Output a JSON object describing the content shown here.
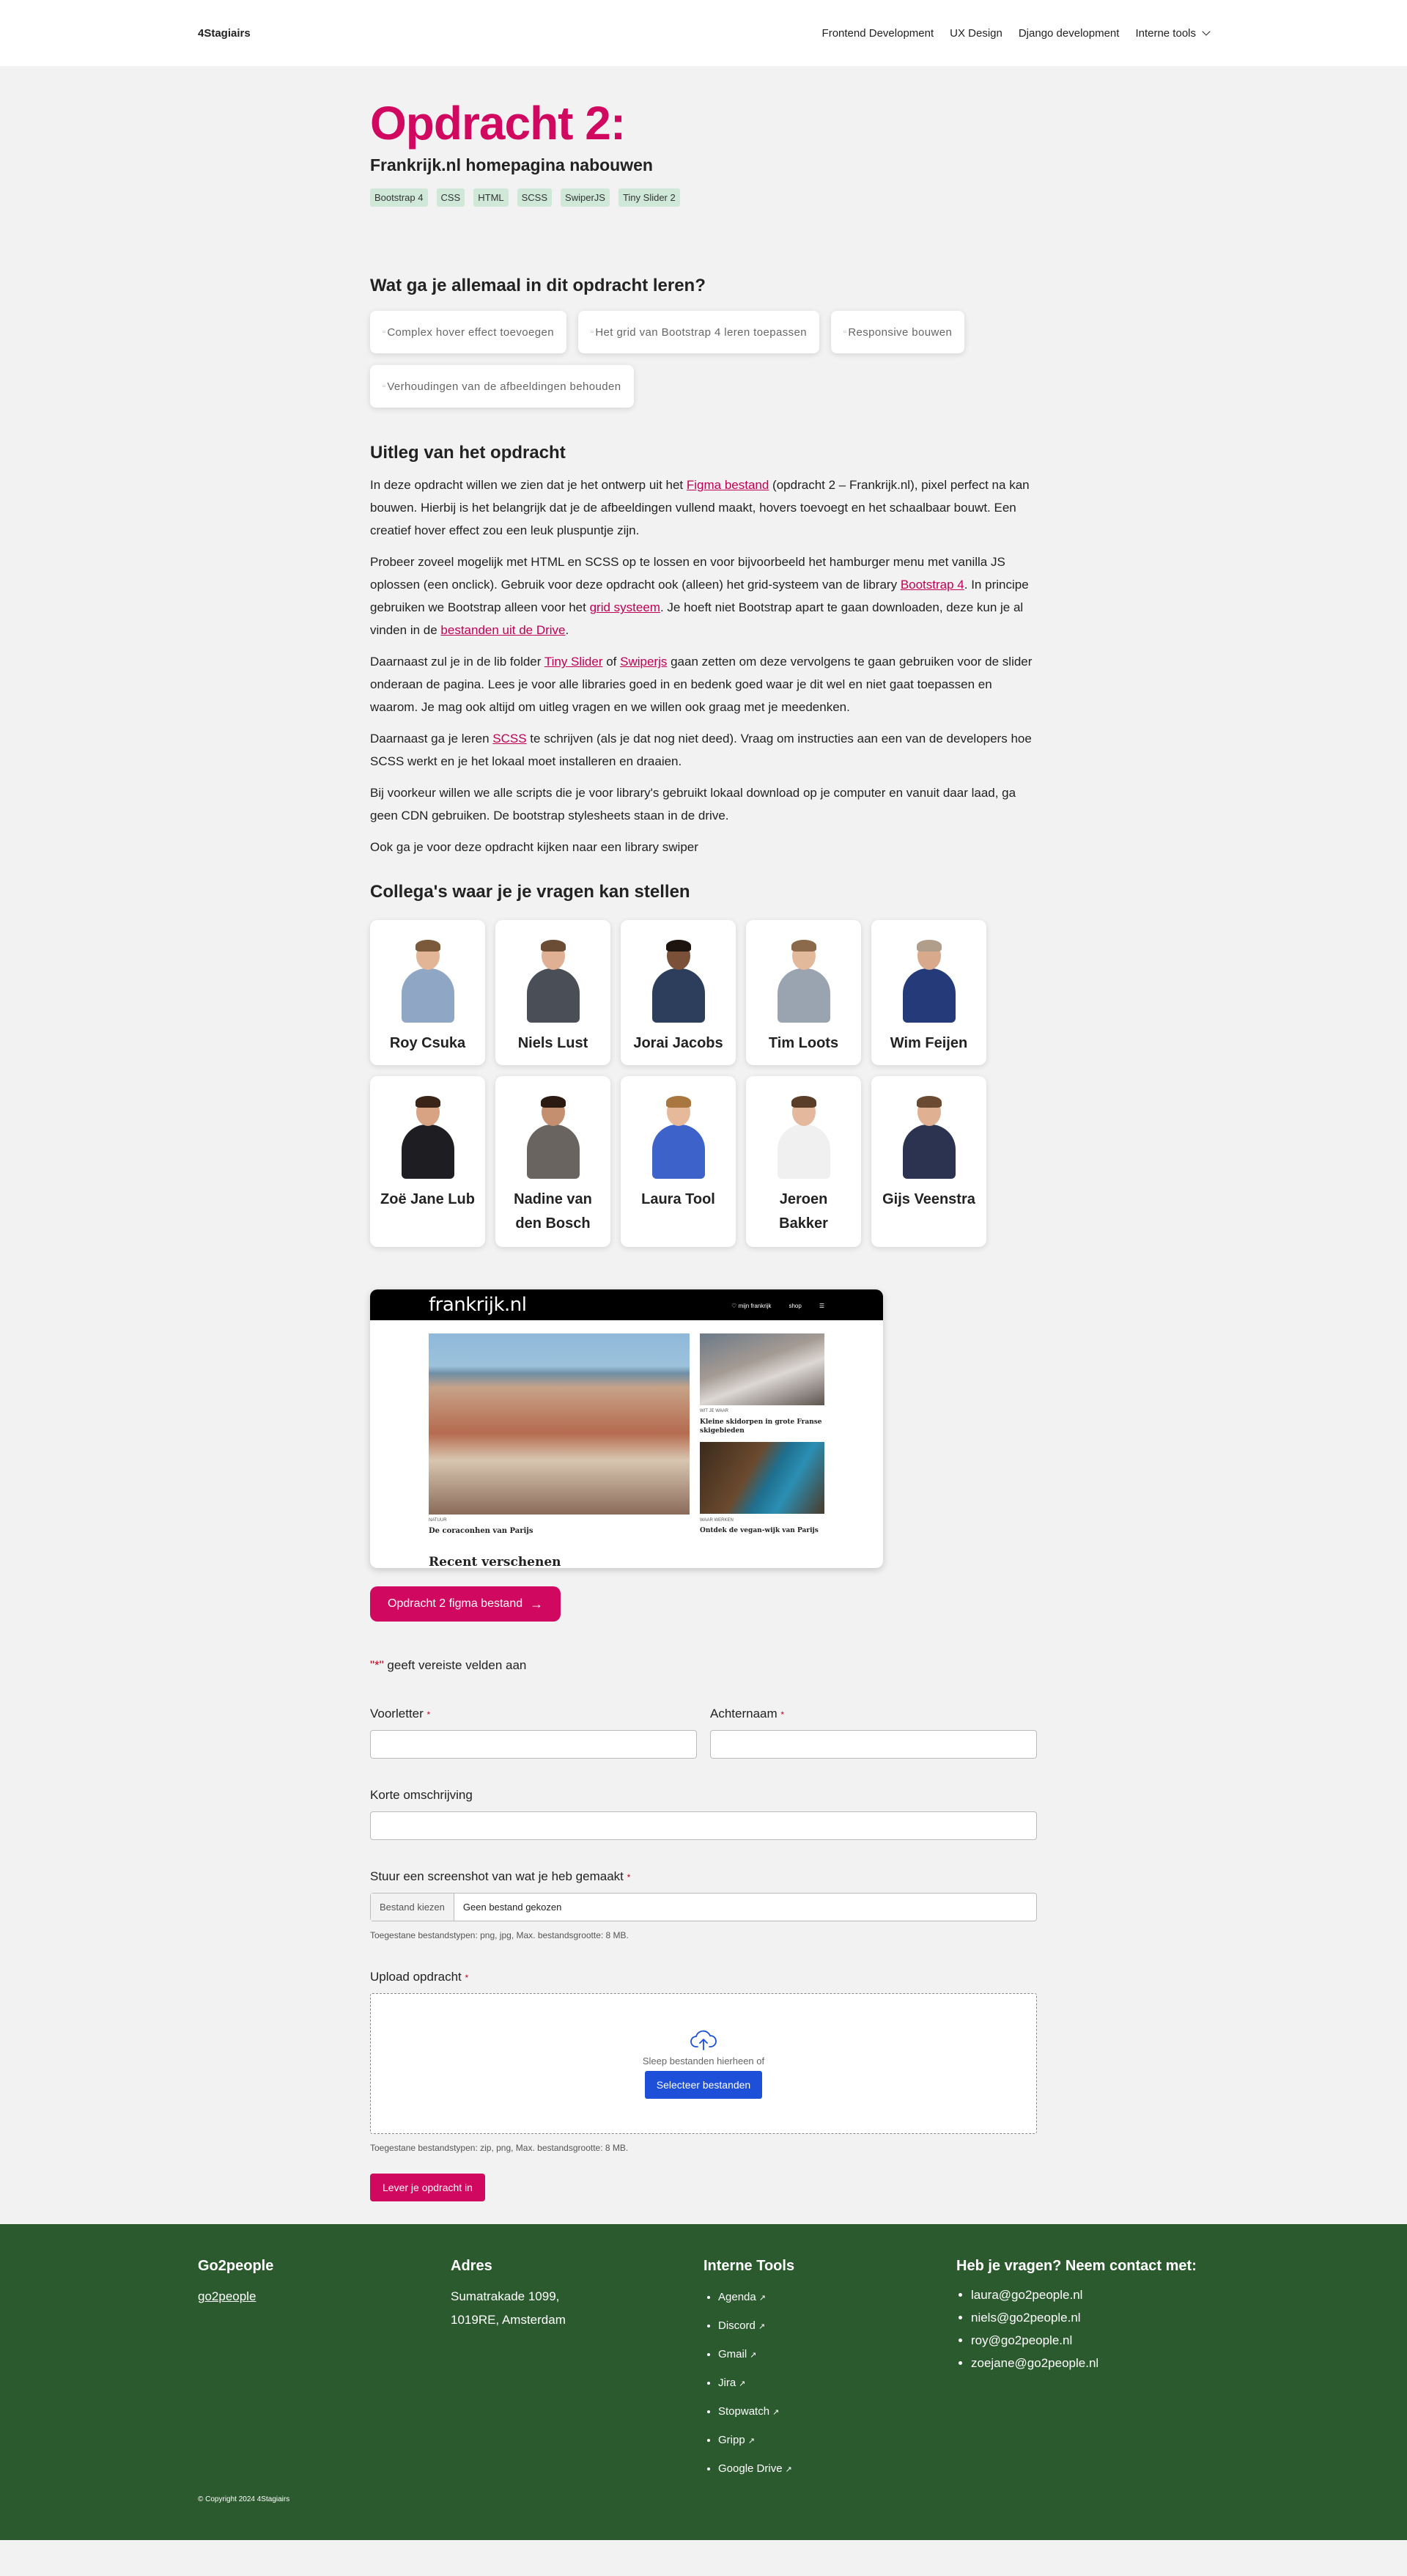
{
  "nav": {
    "logo": "4Stagiairs",
    "links": [
      "Frontend Development",
      "UX Design",
      "Django development",
      "Interne tools"
    ]
  },
  "header": {
    "title": "Opdracht 2:",
    "subtitle": "Frankrijk.nl homepagina nabouwen",
    "tags": [
      "Bootstrap 4",
      "CSS",
      "HTML",
      "SCSS",
      "SwiperJS",
      "Tiny Slider 2"
    ]
  },
  "learn": {
    "title": "Wat ga je allemaal in dit opdracht leren?",
    "items": [
      "Complex hover effect toevoegen",
      "Het grid van Bootstrap 4 leren toepassen",
      "Responsive bouwen",
      "Verhoudingen van de afbeeldingen behouden"
    ]
  },
  "explain": {
    "title": "Uitleg van het opdracht",
    "p1a": "In deze opdracht willen we zien dat je het ontwerp uit het ",
    "p1link": "Figma bestand",
    "p1b": " (opdracht 2 – Frankrijk.nl), pixel perfect na kan bouwen. Hierbij is het belangrijk dat je de afbeeldingen vullend maakt, hovers toevoegt en het schaalbaar bouwt. Een creatief hover effect zou een leuk pluspuntje zijn.",
    "p2a": "Probeer zoveel mogelijk met HTML en SCSS op te lossen en voor bijvoorbeeld het hamburger menu met vanilla JS oplossen (een onclick). Gebruik voor deze opdracht ook (alleen) het grid-systeem van de library ",
    "p2link1": "Bootstrap 4",
    "p2b": ". In principe gebruiken we Bootstrap alleen voor het ",
    "p2link2": "grid systeem",
    "p2c": ". Je hoeft niet Bootstrap apart te gaan downloaden, deze kun je al vinden in de ",
    "p2link3": "bestanden uit de Drive",
    "p2d": ".",
    "p3a": "Daarnaast zul je in de lib folder ",
    "p3link1": "Tiny Slider",
    "p3b": " of ",
    "p3link2": "Swiperjs",
    "p3c": " gaan zetten om deze vervolgens te gaan gebruiken voor de slider onderaan de pagina. Lees je voor alle libraries goed in en bedenk goed waar je dit wel en niet gaat toepassen en waarom. Je mag ook altijd om uitleg vragen en we willen ook graag met je meedenken.",
    "p4a": "Daarnaast ga je leren ",
    "p4link": "SCSS",
    "p4b": " te schrijven (als je dat nog niet deed). Vraag om instructies aan een van de developers hoe SCSS werkt en je het lokaal moet installeren en draaien.",
    "p5": "Bij voorkeur willen we alle scripts die je voor library's gebruikt lokaal download op je computer en vanuit daar laad, ga geen CDN gebruiken. De bootstrap stylesheets staan in de drive.",
    "p6": "Ook ga je voor deze opdracht kijken naar een library swiper"
  },
  "colleagues": {
    "title": "Collega's waar je je vragen kan stellen",
    "people": [
      {
        "name": "Roy Csuka",
        "shirt": "#8fa7c4",
        "skin": "#e2b597",
        "hair": "#7a5a3a"
      },
      {
        "name": "Niels Lust",
        "shirt": "#4a4f57",
        "skin": "#e0b094",
        "hair": "#6b4c34"
      },
      {
        "name": "Jorai Jacobs",
        "shirt": "#2d3e5c",
        "skin": "#7a5038",
        "hair": "#1d1410"
      },
      {
        "name": "Tim Loots",
        "shirt": "#9aa4b0",
        "skin": "#e3b99c",
        "hair": "#8a6a4a"
      },
      {
        "name": "Wim Feijen",
        "shirt": "#253a78",
        "skin": "#d9a98b",
        "hair": "#b09e8a"
      },
      {
        "name": "Zoë Jane Lub",
        "shirt": "#1e1e22",
        "skin": "#d7a383",
        "hair": "#3a2418"
      },
      {
        "name": "Nadine van den Bosch",
        "shirt": "#6a6460",
        "skin": "#c48f6e",
        "hair": "#2a1a12"
      },
      {
        "name": "Laura Tool",
        "shirt": "#3d62c9",
        "skin": "#e6b99a",
        "hair": "#a8763e"
      },
      {
        "name": "Jeroen Bakker",
        "shirt": "#f0f0f0",
        "skin": "#e4b89c",
        "hair": "#5a3e2a"
      },
      {
        "name": "Gijs Veenstra",
        "shirt": "#2c3350",
        "skin": "#e0b093",
        "hair": "#6a4a30"
      }
    ]
  },
  "preview": {
    "logo": "frankrijk.nl",
    "menu": [
      "♡ mijn frankrijk",
      "shop",
      "☰"
    ],
    "big_caption": "NATUUR",
    "big_title": "De coraconhen van Parijs",
    "recent": "Recent verschenen",
    "s1_caption": "WIT JE WAAR",
    "s1_title": "Kleine skidorpen in grote Franse skigebieden",
    "s2_caption": "WAAR WERKEN",
    "s2_title": "Ontdek de vegan-wijk van Parijs"
  },
  "figma_button": "Opdracht 2 figma bestand",
  "form": {
    "required_stars": "\"*\"",
    "required_text": " geeft vereiste velden aan",
    "first_label": "Voorletter",
    "last_label": "Achternaam",
    "req_mark": "*",
    "desc_label": "Korte omschrijving",
    "screenshot_label": "Stuur een screenshot van wat je heb gemaakt",
    "file_button": "Bestand kiezen",
    "file_text": "Geen bestand gekozen",
    "screenshot_hint": "Toegestane bestandstypen: png, jpg, Max. bestandsgrootte: 8 MB.",
    "upload_label": "Upload opdracht",
    "drop_text": "Sleep bestanden hierheen of",
    "select_button": "Selecteer bestanden",
    "upload_hint": "Toegestane bestandstypen: zip, png, Max. bestandsgrootte: 8 MB.",
    "submit": "Lever je opdracht in"
  },
  "footer": {
    "col1_title": "Go2people",
    "col1_link": "go2people",
    "col2_title": "Adres",
    "col2_line1": "Sumatrakade 1099,",
    "col2_line2": "1019RE, Amsterdam",
    "col3_title": "Interne Tools",
    "tools": [
      "Agenda",
      "Discord",
      "Gmail",
      "Jira",
      "Stopwatch",
      "Gripp",
      "Google Drive"
    ],
    "col4_title": "Heb je vragen? Neem contact met:",
    "emails": [
      "laura@go2people.nl",
      "niels@go2people.nl",
      "roy@go2people.nl",
      "zoejane@go2people.nl"
    ],
    "copyright": "© Copyright 2024 4Stagiairs"
  }
}
